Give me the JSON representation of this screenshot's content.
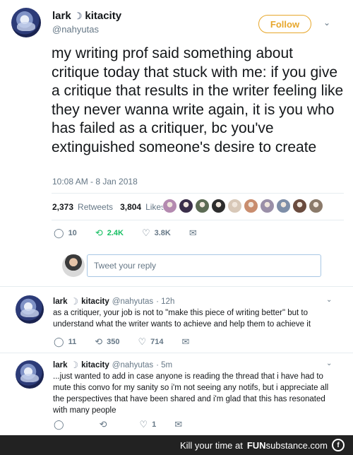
{
  "main_tweet": {
    "display_name": "lark",
    "display_suffix": "kitacity",
    "moon": "☽",
    "handle": "@nahyutas",
    "follow_label": "Follow",
    "text": "my writing prof said something about critique today that stuck with me: if you give a critique that results in the writer feeling like they never wanna write again, it is you who has failed as a critiquer, bc you've extinguished someone's desire to create",
    "timestamp": "10:08 AM - 8 Jan 2018",
    "retweets_count": "2,373",
    "retweets_label": "Retweets",
    "likes_count": "3,804",
    "likes_label": "Likes",
    "liker_colors": [
      "#b48ab0",
      "#3b2f4a",
      "#5c6b54",
      "#2d2d2d",
      "#d8c8b8",
      "#c98d6e",
      "#9a8fa8",
      "#7e8ea8",
      "#6a4b3e",
      "#8b7a6a"
    ],
    "actions": {
      "replies": "10",
      "retweets": "2.4K",
      "likes": "3.8K"
    },
    "accent_color": "#e7a72c"
  },
  "reply_box": {
    "placeholder": "Tweet your reply"
  },
  "replies": [
    {
      "display_name": "lark",
      "display_suffix": "kitacity",
      "moon": "☽",
      "handle": "@nahyutas",
      "time": "· 12h",
      "text": "as a critiquer, your job is not to \"make this piece of writing better\" but to understand what the writer wants to achieve and help them to achieve it",
      "actions": {
        "replies": "11",
        "retweets": "350",
        "likes": "714"
      }
    },
    {
      "display_name": "lark",
      "display_suffix": "kitacity",
      "moon": "☽",
      "handle": "@nahyutas",
      "time": "· 5m",
      "text": "...just wanted to add in case anyone is reading the thread that i have had to mute this convo for my sanity so i'm not seeing any notifs, but i appreciate all the perspectives that have been shared and i'm glad that this has resonated with many people",
      "actions": {
        "replies": "",
        "retweets": "",
        "likes": "1"
      }
    }
  ],
  "icons": {
    "reply": "💬",
    "retweet": "⟲",
    "like": "♡",
    "dm": "✉",
    "chevron": "⌄"
  },
  "watermark": {
    "prefix": "Kill your time at",
    "brand_fun": "FUN",
    "brand_rest": "substance.com",
    "logo_letter": "f"
  }
}
